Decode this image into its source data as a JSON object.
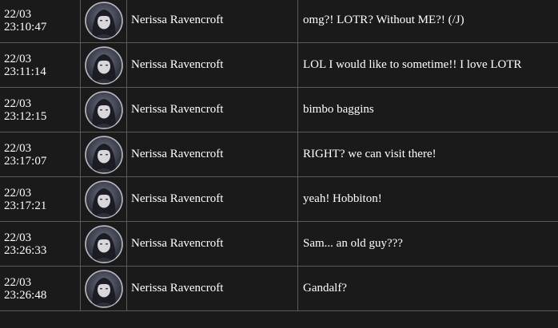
{
  "messages": [
    {
      "date": "22/03",
      "time": "23:10:47",
      "avatar": "user-avatar",
      "name": "Nerissa Ravencroft",
      "text": "omg?! LOTR? Without ME?! (/J)"
    },
    {
      "date": "22/03",
      "time": "23:11:14",
      "avatar": "user-avatar",
      "name": "Nerissa Ravencroft",
      "text": "LOL I would like to sometime!! I love LOTR"
    },
    {
      "date": "22/03",
      "time": "23:12:15",
      "avatar": "user-avatar",
      "name": "Nerissa Ravencroft",
      "text": "bimbo baggins"
    },
    {
      "date": "22/03",
      "time": "23:17:07",
      "avatar": "user-avatar",
      "name": "Nerissa Ravencroft",
      "text": "RIGHT? we can visit there!"
    },
    {
      "date": "22/03",
      "time": "23:17:21",
      "avatar": "user-avatar",
      "name": "Nerissa Ravencroft",
      "text": "yeah! Hobbiton!"
    },
    {
      "date": "22/03",
      "time": "23:26:33",
      "avatar": "user-avatar",
      "name": "Nerissa Ravencroft",
      "text": "Sam... an old guy???"
    },
    {
      "date": "22/03",
      "time": "23:26:48",
      "avatar": "user-avatar",
      "name": "Nerissa Ravencroft",
      "text": "Gandalf?"
    }
  ],
  "colors": {
    "background": "#1a1a1a",
    "border": "#5a5a5a",
    "text": "#ffffff"
  }
}
